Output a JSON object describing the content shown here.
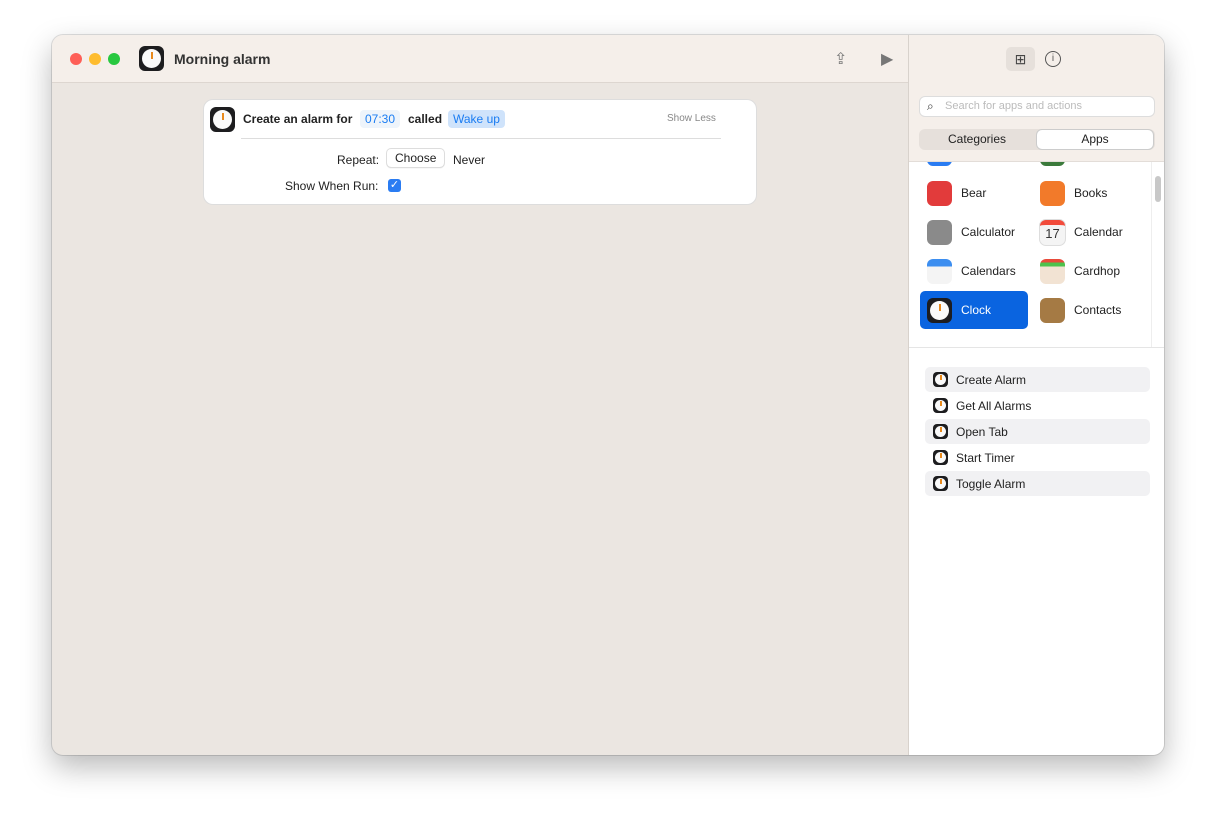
{
  "window": {
    "title": "Morning alarm"
  },
  "action_card": {
    "prefix": "Create an alarm for",
    "time": "07:30",
    "called": "called",
    "name": "Wake up",
    "show_less": "Show Less",
    "repeat_label": "Repeat:",
    "choose": "Choose",
    "repeat_value": "Never",
    "show_when_run_label": "Show When Run:",
    "show_when_run": true
  },
  "sidebar": {
    "search_placeholder": "Search for apps and actions",
    "tabs": [
      "Categories",
      "Apps"
    ],
    "selected_tab": "Apps",
    "apps": [
      {
        "name": "Bear",
        "color": "#e23b3b"
      },
      {
        "name": "Books",
        "color": "#f27a2a"
      },
      {
        "name": "Calculator",
        "color": "#8a8a8a"
      },
      {
        "name": "Calendar",
        "color": "#f4f4f4"
      },
      {
        "name": "Calendars",
        "color": "#3c8ef0"
      },
      {
        "name": "Cardhop",
        "color": "#f2e3d3"
      },
      {
        "name": "Clock",
        "color": "#1d1d1f"
      },
      {
        "name": "Contacts",
        "color": "#a57a44"
      }
    ],
    "selected_app": "Clock",
    "actions": [
      "Create Alarm",
      "Get All Alarms",
      "Open Tab",
      "Start Timer",
      "Toggle Alarm"
    ]
  }
}
